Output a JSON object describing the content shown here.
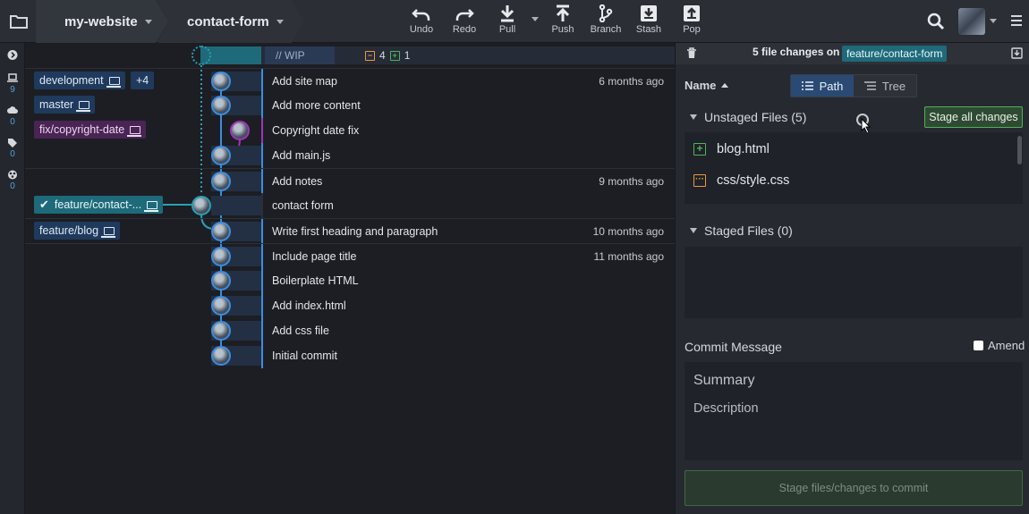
{
  "toolbar": {
    "repo": "my-website",
    "branch": "contact-form",
    "buttons": {
      "undo": "Undo",
      "redo": "Redo",
      "pull": "Pull",
      "push": "Push",
      "branch": "Branch",
      "stash": "Stash",
      "pop": "Pop"
    }
  },
  "rail": {
    "local_count": "9",
    "remote_count": "0",
    "tags_count": "0",
    "submodules_count": "0"
  },
  "graph": {
    "wip_label": "// WIP",
    "wip_modified": "4",
    "wip_added": "1",
    "branch_labels": {
      "development": "development",
      "more": "+4",
      "master": "master",
      "copyright": "fix/copyright-date",
      "contact": "feature/contact-...",
      "blog": "feature/blog"
    },
    "commits": [
      {
        "message": "Add site map",
        "ago": "6 months ago"
      },
      {
        "message": "Add more content",
        "ago": ""
      },
      {
        "message": "Copyright date fix",
        "ago": ""
      },
      {
        "message": "Add main.js",
        "ago": ""
      },
      {
        "message": "Add notes",
        "ago": "9 months ago"
      },
      {
        "message": "contact form",
        "ago": ""
      },
      {
        "message": "Write first heading and paragraph",
        "ago": "10 months ago"
      },
      {
        "message": "Include page title",
        "ago": "11 months ago"
      },
      {
        "message": "Boilerplate HTML",
        "ago": ""
      },
      {
        "message": "Add index.html",
        "ago": ""
      },
      {
        "message": "Add css file",
        "ago": ""
      },
      {
        "message": "Initial commit",
        "ago": ""
      }
    ]
  },
  "panel": {
    "title": "5 file changes on",
    "branch": "feature/contact-form",
    "sort_label": "Name",
    "view_path": "Path",
    "view_tree": "Tree",
    "unstaged_title": "Unstaged Files (5)",
    "stage_all": "Stage all changes",
    "files": [
      {
        "name": "blog.html",
        "status": "added"
      },
      {
        "name": "css/style.css",
        "status": "modified"
      }
    ],
    "staged_title": "Staged Files (0)",
    "commit_label": "Commit Message",
    "amend_label": "Amend",
    "summary_placeholder": "Summary",
    "description_placeholder": "Description",
    "commit_button": "Stage files/changes to commit"
  },
  "colors": {
    "accent_blue": "#3d8de0",
    "accent_purple": "#a033b8",
    "accent_teal": "#1e6a7a",
    "added_green": "#4fb35a",
    "modified_orange": "#e89a3c"
  }
}
